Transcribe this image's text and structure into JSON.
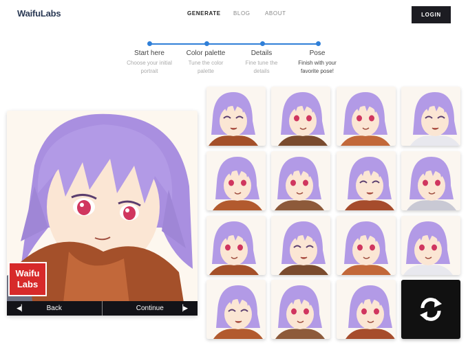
{
  "header": {
    "logo_text": "Waifu",
    "logo_accent": "Labs",
    "nav": [
      {
        "label": "GENERATE",
        "active": true
      },
      {
        "label": "BLOG",
        "active": false
      },
      {
        "label": "ABOUT",
        "active": false
      }
    ],
    "login_label": "LOGIN"
  },
  "stepper": {
    "accent_color": "#2f7fd8",
    "steps": [
      {
        "title": "Start here",
        "desc_1": "Choose your initial",
        "desc_2": "portrait"
      },
      {
        "title": "Color palette",
        "desc_1": "Tune the color",
        "desc_2": "palette"
      },
      {
        "title": "Details",
        "desc_1": "Fine tune the",
        "desc_2": "details"
      },
      {
        "title": "Pose",
        "desc_1": "Finish with your",
        "desc_2": "favorite pose!"
      }
    ]
  },
  "preview": {
    "badge_line1": "Waifu",
    "badge_line2": "Labs",
    "back_label": "Back",
    "continue_label": "Continue"
  },
  "grid": {
    "tile_count": 15,
    "hair_color": "#b29ae6",
    "regenerate_icon": "refresh-icon"
  }
}
